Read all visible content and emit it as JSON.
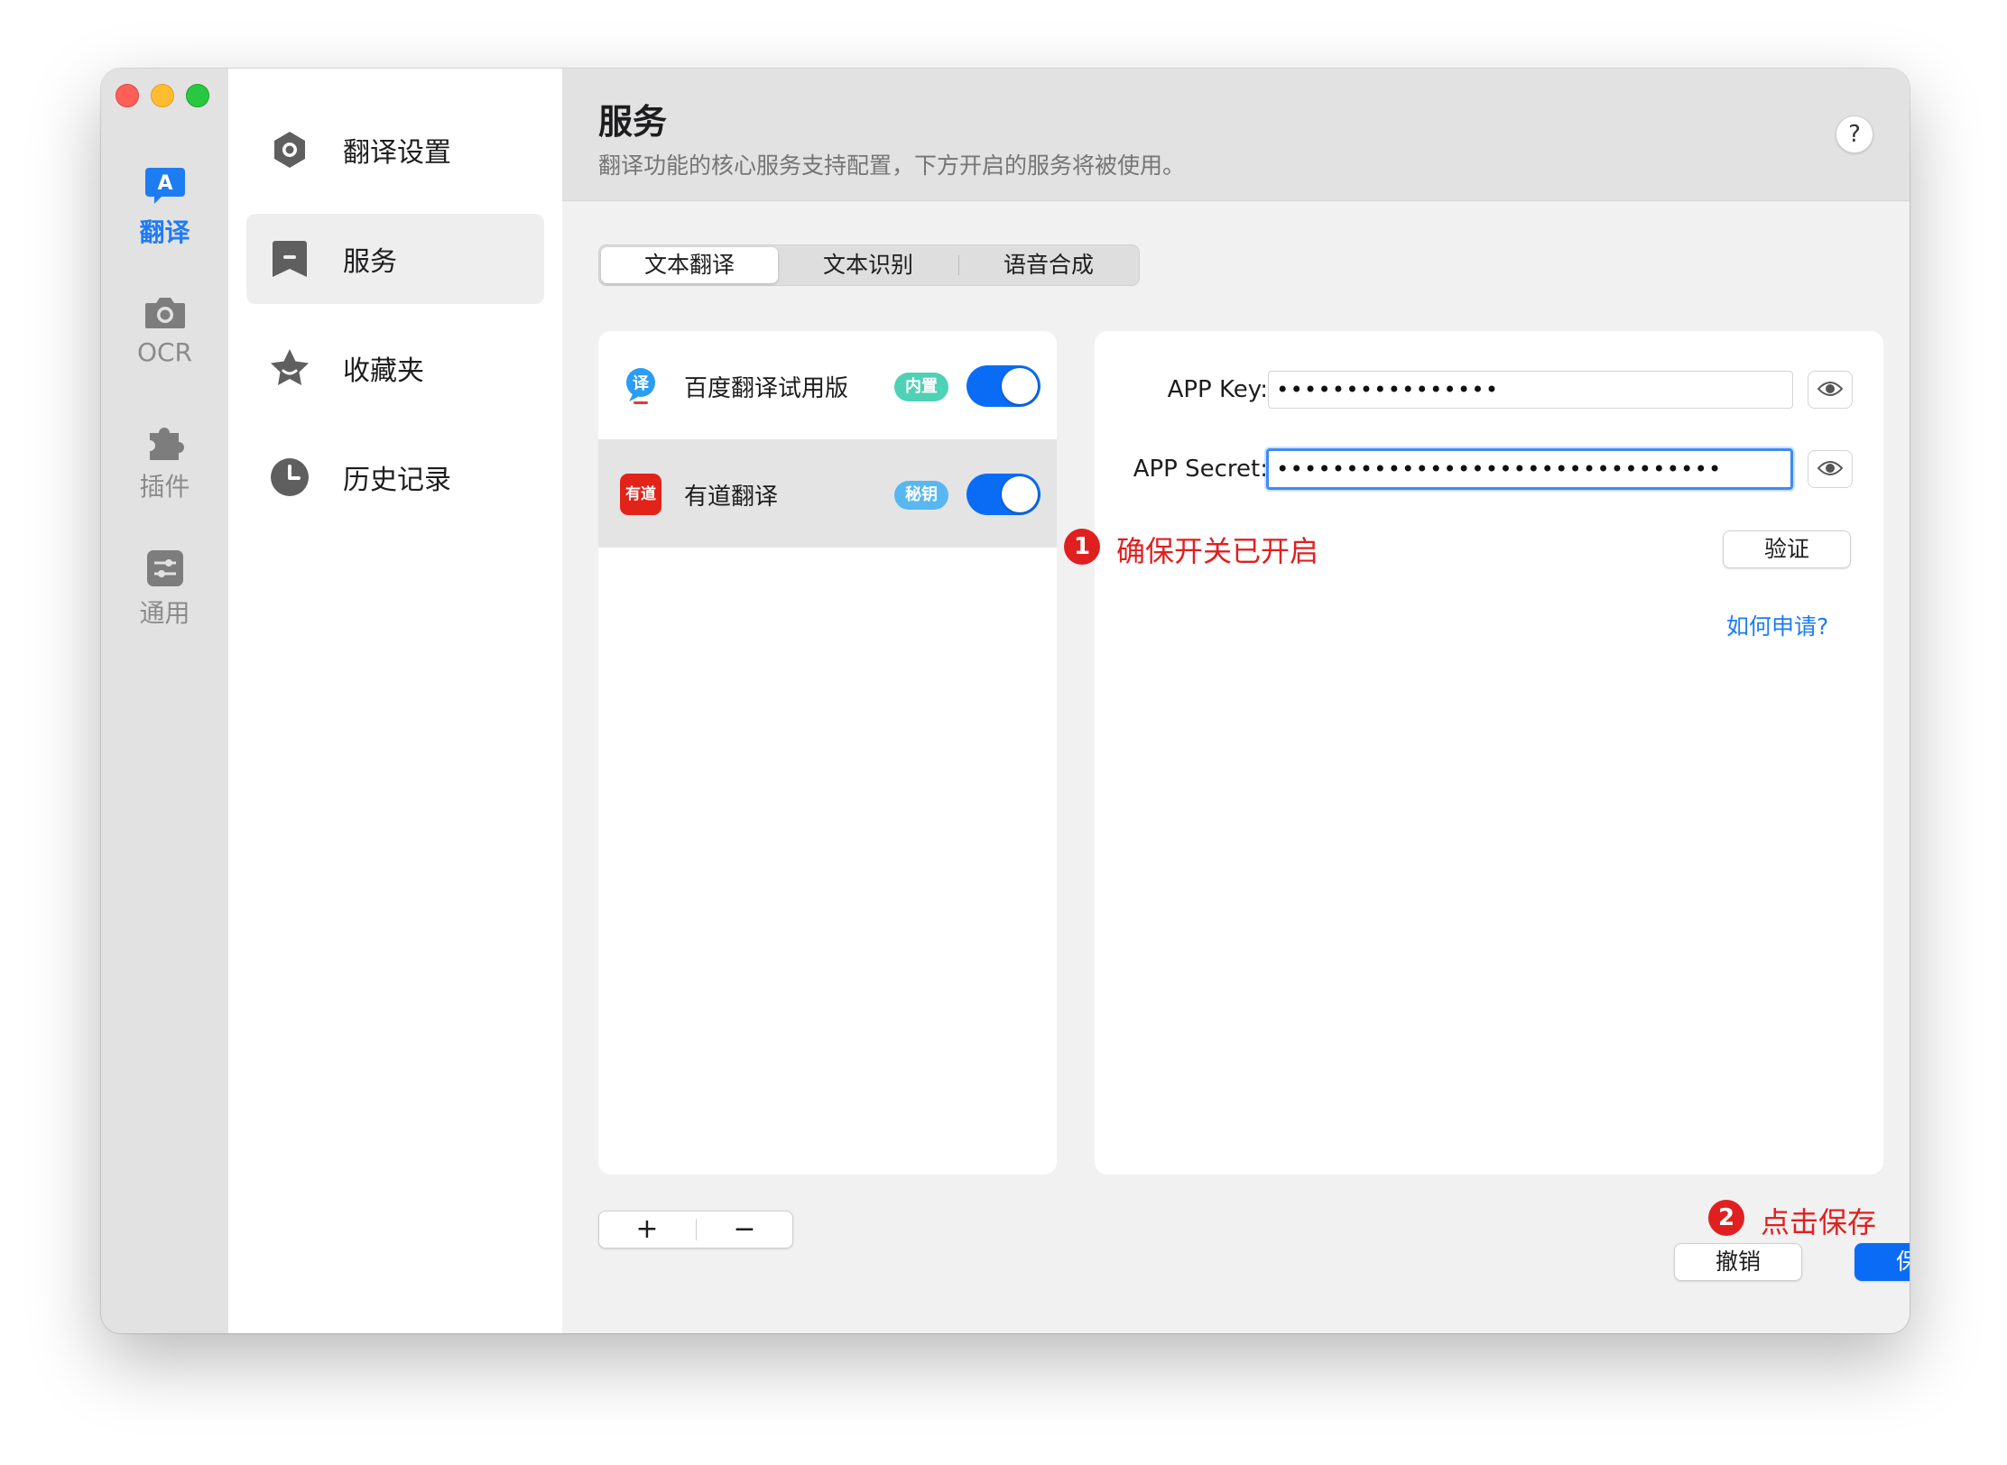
{
  "rail": {
    "items": [
      {
        "label": "翻译",
        "icon": "translate-icon",
        "active": true
      },
      {
        "label": "OCR",
        "icon": "camera-icon",
        "active": false
      },
      {
        "label": "插件",
        "icon": "puzzle-icon",
        "active": false
      },
      {
        "label": "通用",
        "icon": "sliders-icon",
        "active": false
      }
    ]
  },
  "sidenav": {
    "items": [
      {
        "label": "翻译设置",
        "icon": "gear-icon"
      },
      {
        "label": "服务",
        "icon": "bookmark-icon",
        "selected": true
      },
      {
        "label": "收藏夹",
        "icon": "star-icon"
      },
      {
        "label": "历史记录",
        "icon": "clock-icon"
      }
    ]
  },
  "header": {
    "title": "服务",
    "subtitle": "翻译功能的核心服务支持配置，下方开启的服务将被使用。",
    "help": "?"
  },
  "tabs": [
    {
      "label": "文本翻译",
      "active": true
    },
    {
      "label": "文本识别",
      "active": false
    },
    {
      "label": "语音合成",
      "active": false
    }
  ],
  "services": [
    {
      "name": "百度翻译试用版",
      "badge": "内置",
      "badge_color": "#4ed1b4",
      "enabled": true,
      "icon": "baidu-translate-icon"
    },
    {
      "name": "有道翻译",
      "badge": "秘钥",
      "badge_color": "#58b7f0",
      "enabled": true,
      "icon": "youdao-translate-icon",
      "icon_text": "有道",
      "selected": true
    }
  ],
  "detail": {
    "app_key_label": "APP Key:",
    "app_key_value": "••••••••••••••••",
    "app_secret_label": "APP Secret:",
    "app_secret_value": "••••••••••••••••••••••••••••••••",
    "verify_label": "验证",
    "how_to_apply": "如何申请?"
  },
  "list_controls": {
    "add": "+",
    "remove": "−"
  },
  "footer": {
    "cancel": "撤销",
    "save": "保存"
  },
  "annotations": [
    {
      "number": "1",
      "text": "确保开关已开启"
    },
    {
      "number": "2",
      "text": "点击保存"
    }
  ],
  "colors": {
    "accent": "#0a6cf4",
    "annotation": "#e02020",
    "close": "#ff5f57",
    "minimize": "#febc2e",
    "maximize": "#28c840"
  }
}
